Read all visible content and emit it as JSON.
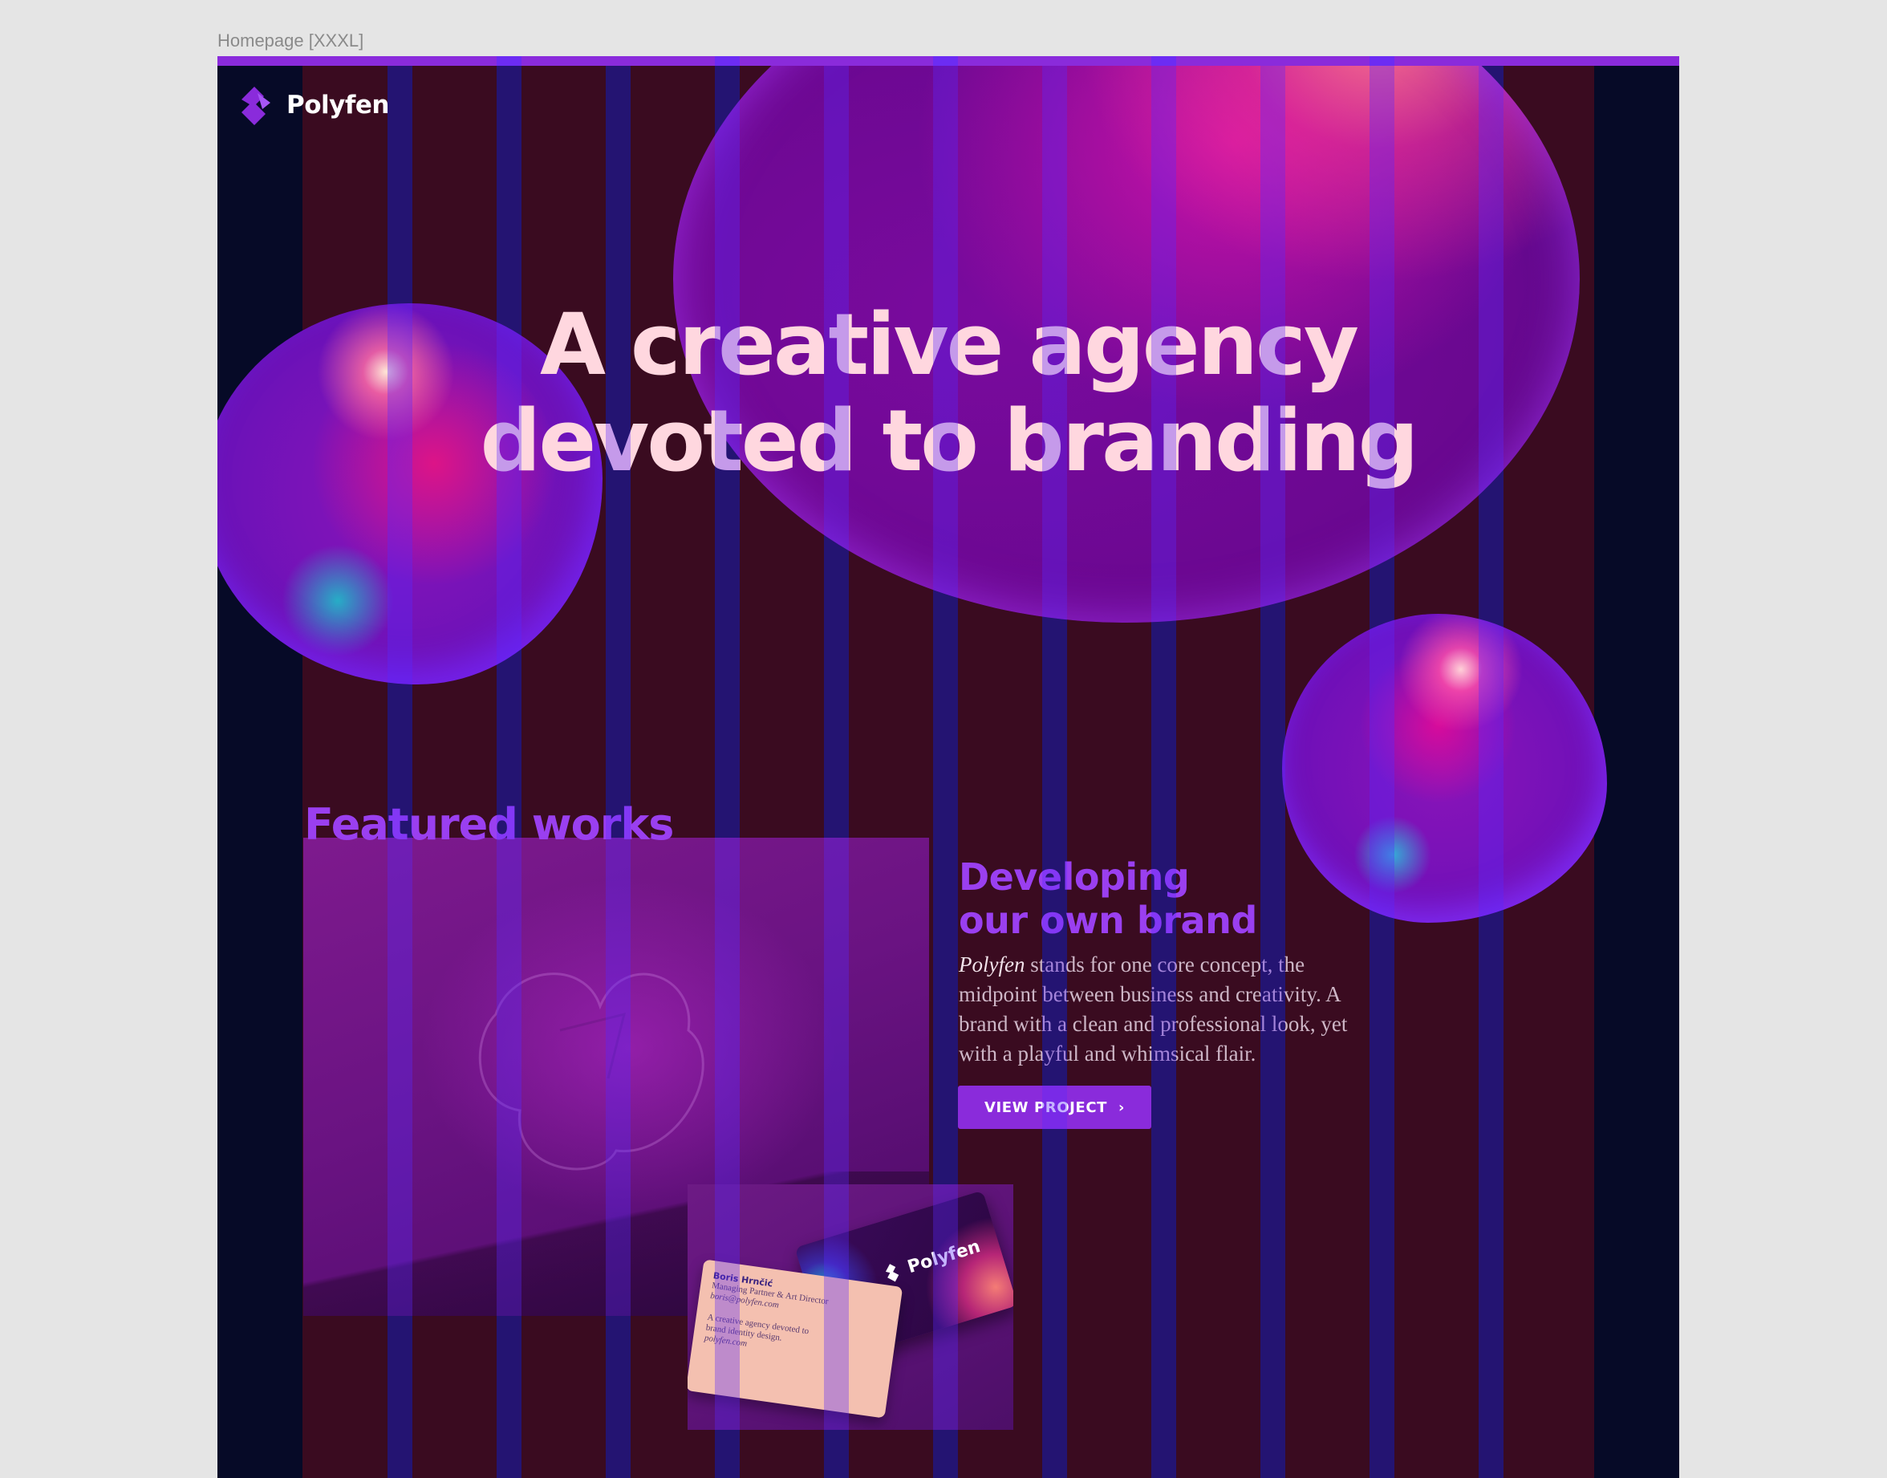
{
  "frame": {
    "label": "Homepage [XXXL]"
  },
  "brand": {
    "name": "Polyfen",
    "accent": "#8a2bdb",
    "background": "#3a0b20",
    "gutter": "#060a22"
  },
  "hero": {
    "line1": "A creative agency",
    "line2": "devoted to branding"
  },
  "featured": {
    "title": "Featured works",
    "project": {
      "title_line1": "Developing",
      "title_line2": "our own brand",
      "desc_brand": "Polyfen",
      "desc_rest": " stands for one core concept, the midpoint between business and creativity. A brand with a clean and professional look, yet with a playful and whimsical flair.",
      "button_label": "VIEW PROJECT",
      "button_icon": "chevron-right-icon"
    }
  },
  "business_card": {
    "brand": "Polyfen",
    "name": "Boris Hrnčić",
    "role": "Managing Partner & Art Director",
    "email": "boris@polyfen.com",
    "tagline_1": "A creative agency devoted to",
    "tagline_2": "brand identity design.",
    "website": "polyfen.com"
  }
}
